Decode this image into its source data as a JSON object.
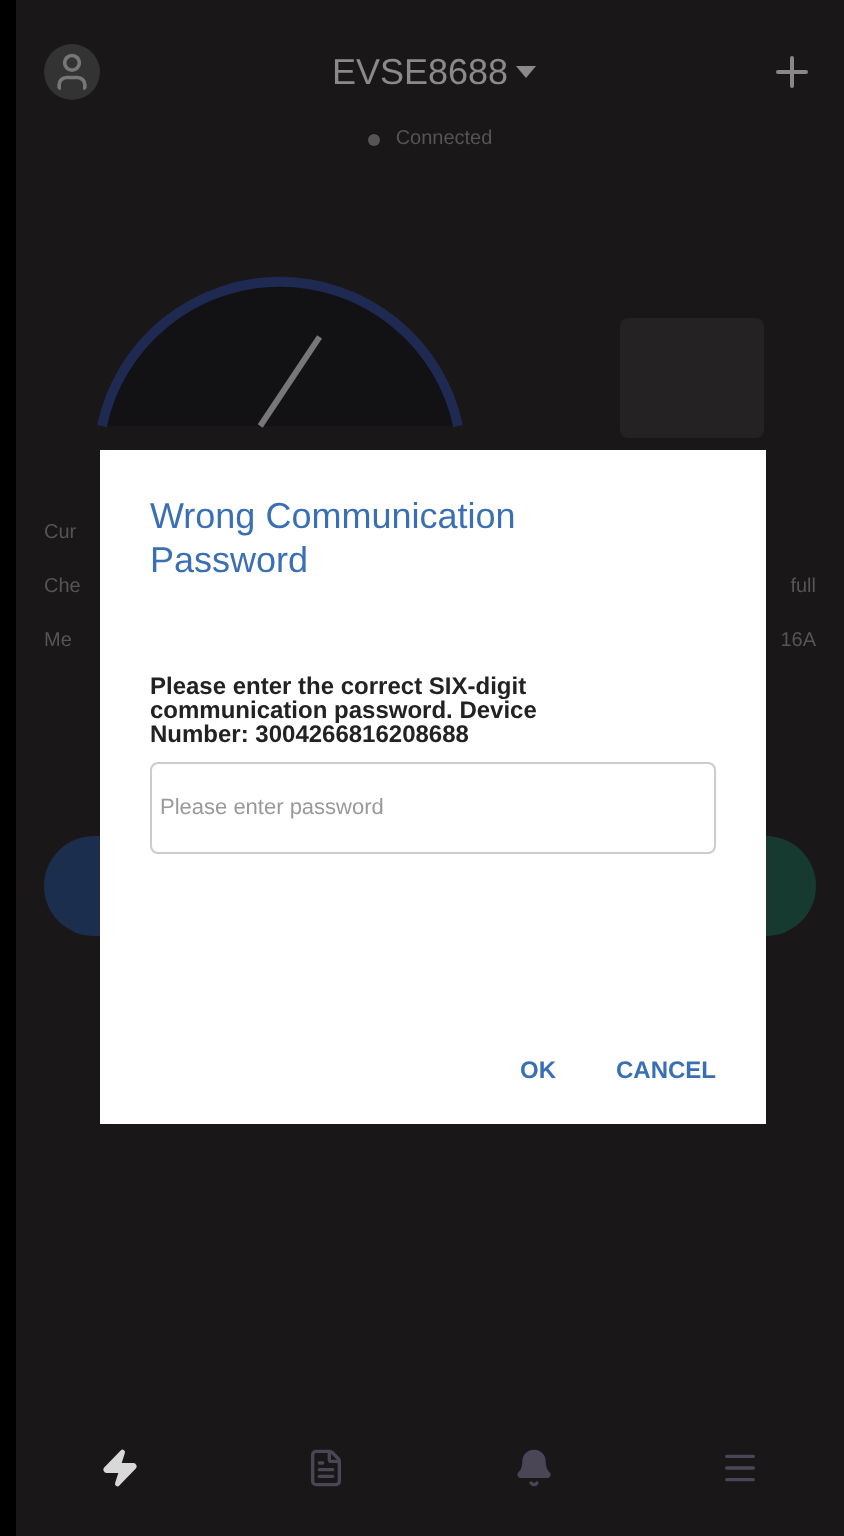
{
  "header": {
    "device": "EVSE8688",
    "status": "Connected"
  },
  "background_rows": [
    {
      "left": "Cur",
      "right": ""
    },
    {
      "left": "Che",
      "right": "full"
    },
    {
      "left": "Me",
      "right": "16A"
    }
  ],
  "bottom_nav": [
    {
      "kind": "charge",
      "selected": true
    },
    {
      "kind": "records",
      "selected": false
    },
    {
      "kind": "alerts",
      "selected": false
    },
    {
      "kind": "menu",
      "selected": false
    }
  ],
  "dialog": {
    "title": "Wrong Communication Password",
    "message": "Please enter the correct SIX-digit communication password. Device Number:  3004266816208688",
    "placeholder": "Please enter password",
    "buttons": [
      "OK",
      "CANCEL"
    ]
  }
}
